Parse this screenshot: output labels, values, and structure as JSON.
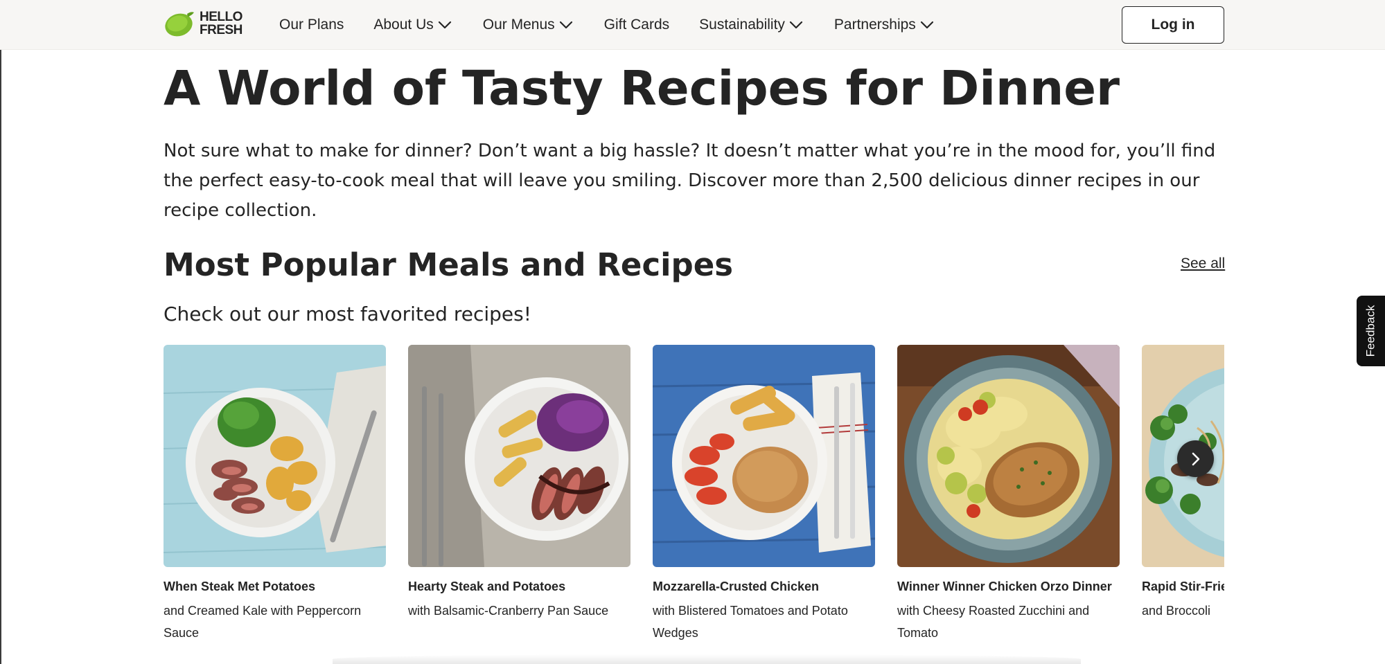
{
  "brand": {
    "line1": "HELLO",
    "line2": "FRESH"
  },
  "nav": {
    "items": [
      {
        "label": "Our Plans",
        "dropdown": false
      },
      {
        "label": "About Us",
        "dropdown": true
      },
      {
        "label": "Our Menus",
        "dropdown": true
      },
      {
        "label": "Gift Cards",
        "dropdown": false
      },
      {
        "label": "Sustainability",
        "dropdown": true
      },
      {
        "label": "Partnerships",
        "dropdown": true
      }
    ],
    "login_label": "Log in"
  },
  "hero": {
    "title": "A World of Tasty Recipes for Dinner",
    "description": "Not sure what to make for dinner? Don’t want a big hassle? It doesn’t matter what you’re in the mood for, you’ll find the perfect easy-to-cook meal that will leave you smiling. Discover more than 2,500 delicious dinner recipes in our recipe collection."
  },
  "popular": {
    "title": "Most Popular Meals and Recipes",
    "see_all": "See all",
    "subtitle": "Check out our most favorited recipes!",
    "recipes": [
      {
        "title": "When Steak Met Potatoes",
        "subtitle": "and Creamed Kale with Peppercorn Sauce"
      },
      {
        "title": "Hearty Steak and Potatoes",
        "subtitle": "with Balsamic-Cranberry Pan Sauce"
      },
      {
        "title": "Mozzarella-Crusted Chicken",
        "subtitle": "with Blistered Tomatoes and Potato Wedges"
      },
      {
        "title": "Winner Winner Chicken Orzo Dinner",
        "subtitle": "with Cheesy Roasted Zucchini and Tomato"
      },
      {
        "title": "Rapid Stir-Fried Beef",
        "subtitle": "and Broccoli"
      }
    ]
  },
  "feedback_label": "Feedback",
  "icons": {
    "logo": "hellofresh-lime-logo",
    "dropdown": "chevron-down-icon",
    "next": "chevron-right-icon"
  },
  "colors": {
    "nav_bg": "#f7f6f4",
    "text": "#242424",
    "brand_lime": "#8cc63f",
    "feedback_bg": "#111111"
  }
}
